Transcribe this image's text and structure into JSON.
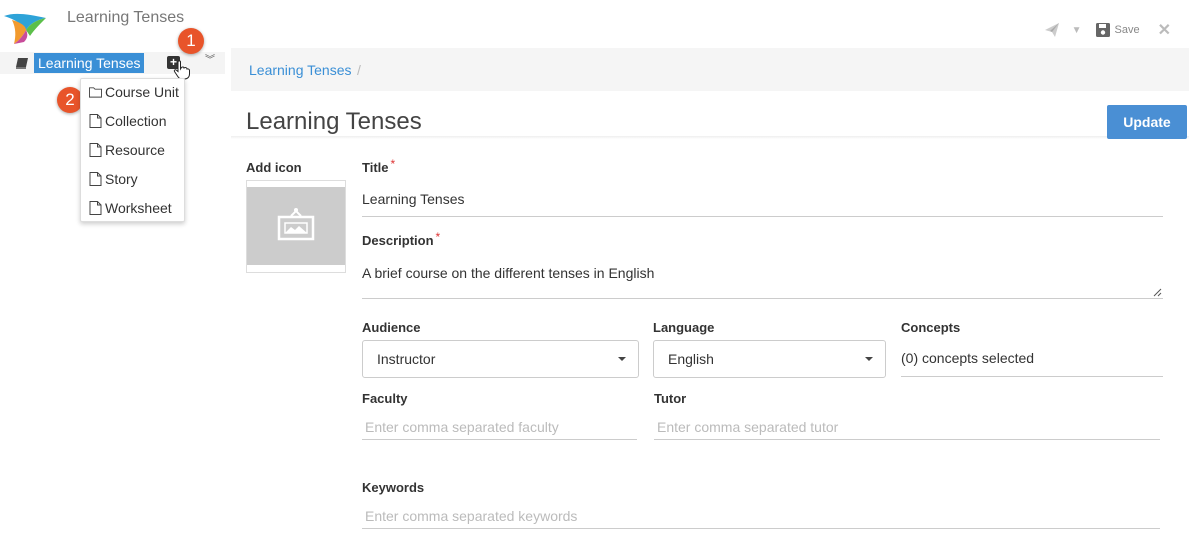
{
  "app": {
    "title": "Learning Tenses"
  },
  "toolbar": {
    "save_label": "Save"
  },
  "tree": {
    "root_label": "Learning Tenses",
    "menu_items": [
      "Course Unit",
      "Collection",
      "Resource",
      "Story",
      "Worksheet"
    ]
  },
  "badges": [
    "1",
    "2"
  ],
  "breadcrumb": {
    "item": "Learning Tenses",
    "separator": "/"
  },
  "page": {
    "title": "Learning Tenses",
    "update_label": "Update"
  },
  "form": {
    "add_icon_label": "Add icon",
    "title_label": "Title",
    "title_value": "Learning Tenses",
    "required_mark": "*",
    "description_label": "Description",
    "description_value": "A brief course on the different tenses in English",
    "audience_label": "Audience",
    "audience_value": "Instructor",
    "language_label": "Language",
    "language_value": "English",
    "concepts_label": "Concepts",
    "concepts_value": "(0) concepts selected",
    "faculty_label": "Faculty",
    "faculty_placeholder": "Enter comma separated faculty",
    "tutor_label": "Tutor",
    "tutor_placeholder": "Enter comma separated tutor",
    "keywords_label": "Keywords",
    "keywords_placeholder": "Enter comma separated keywords"
  },
  "icons": {
    "logo": "hummingbird-logo",
    "send": "paper-plane-icon",
    "save": "floppy-disk-icon",
    "close": "close-icon",
    "book": "book-icon",
    "add": "plus-square-icon",
    "expand": "chevron-double-down-icon",
    "folder": "folder-icon",
    "file": "file-icon",
    "image": "image-placeholder-icon"
  },
  "colors": {
    "accent": "#3a8fd6",
    "button": "#4a8fd4",
    "badge": "#e8542a",
    "required": "#dd3333"
  }
}
